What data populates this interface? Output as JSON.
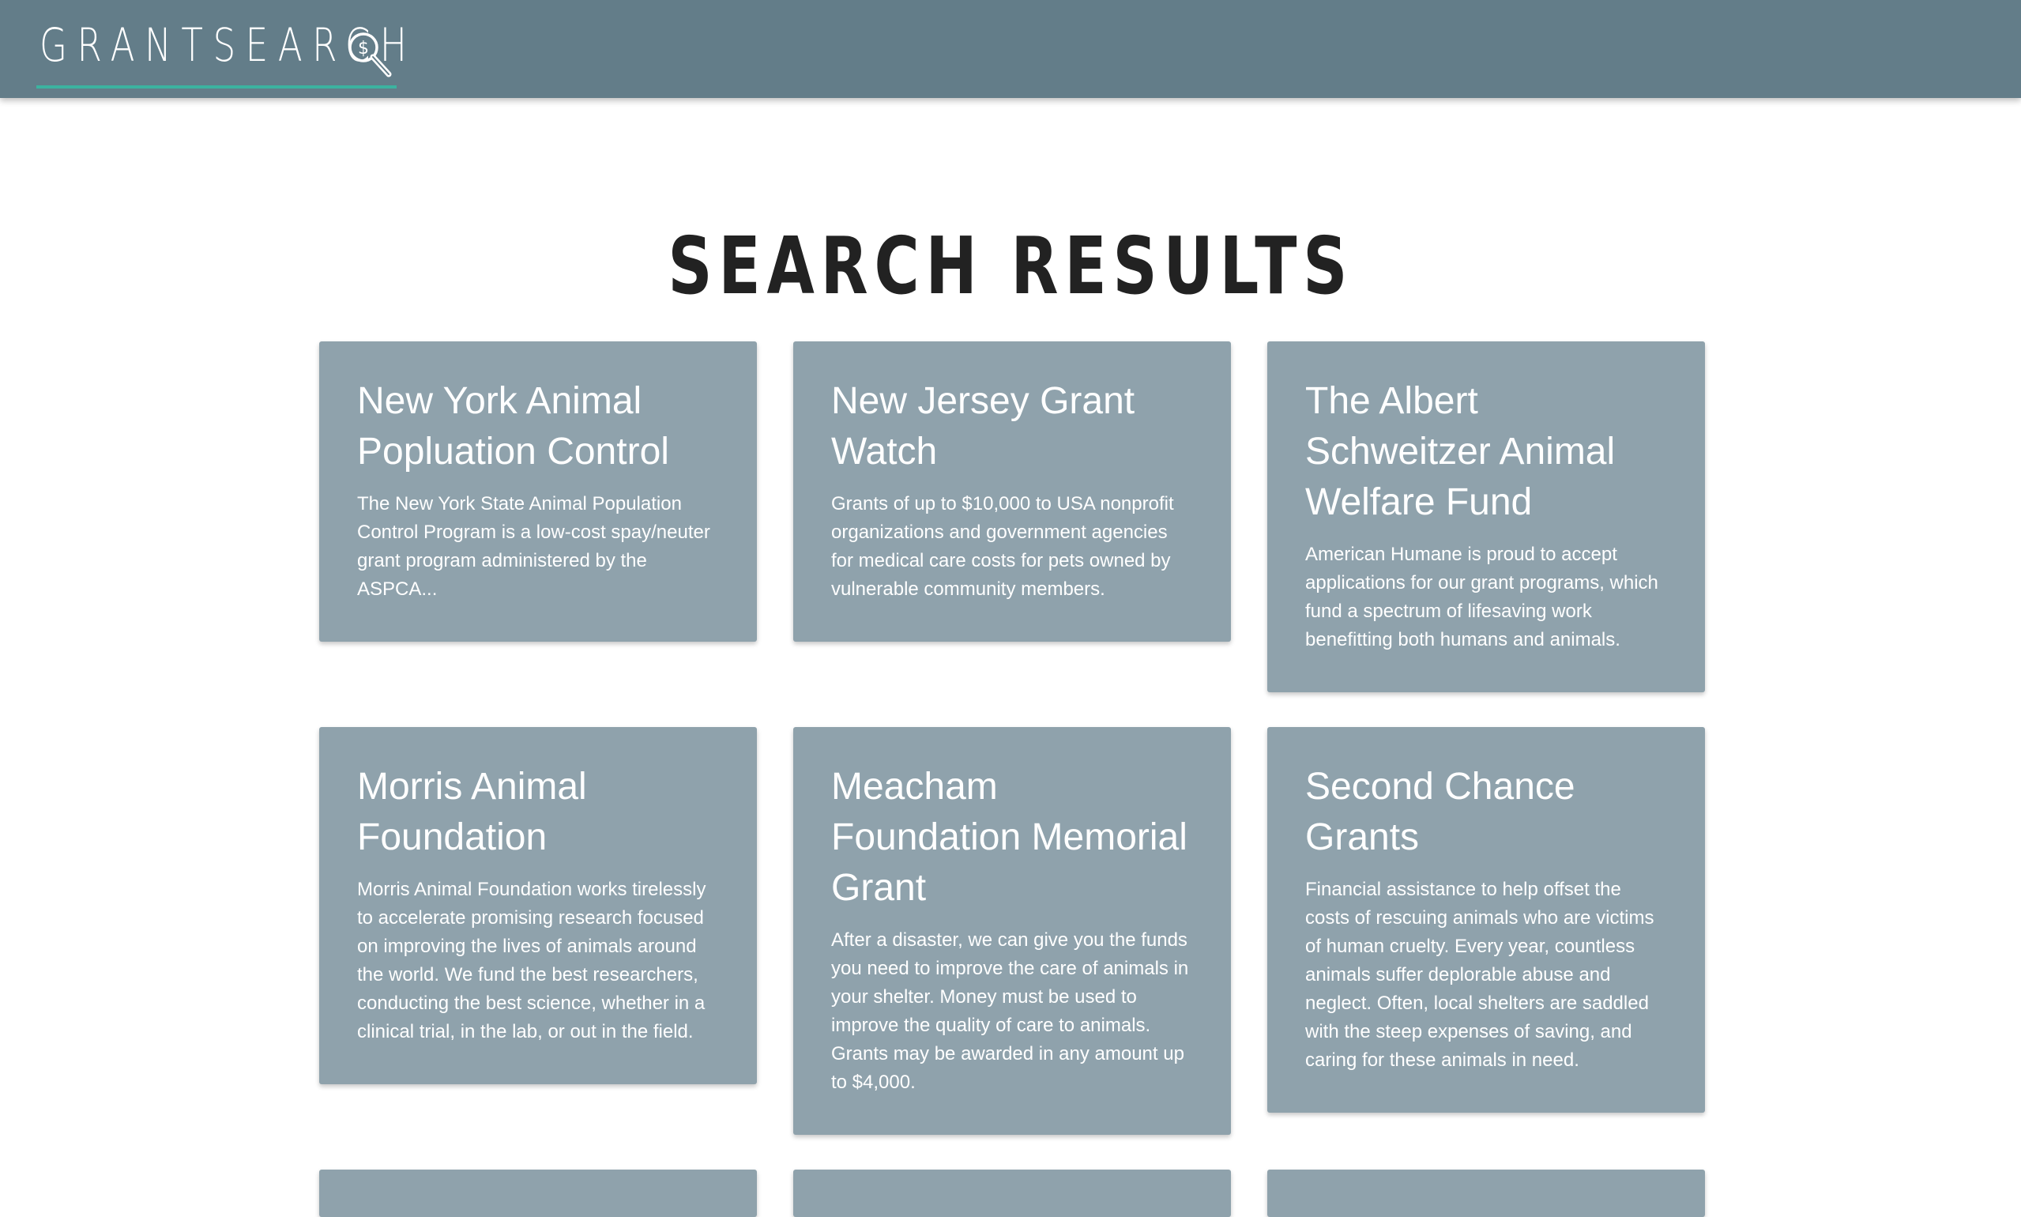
{
  "navbar": {
    "brand": "GRANTSEARCH",
    "brand_icon": "magnifier-dollar-icon",
    "brand_icon_symbol": "$",
    "accent_color": "#3cb3a0",
    "background_color": "#637d89"
  },
  "page": {
    "title": "SEARCH RESULTS"
  },
  "results": [
    {
      "title": "New York Animal Popluation Control",
      "description": "The New York State Animal Population Control Program is a low-cost spay/neuter grant program administered by the ASPCA..."
    },
    {
      "title": "New Jersey Grant Watch",
      "description": "Grants of up to $10,000 to USA nonprofit organizations and government agencies for medical care costs for pets owned by vulnerable community members."
    },
    {
      "title": "The Albert Schweitzer Animal Welfare Fund",
      "description": "American Humane is proud to accept applications for our grant programs, which fund a spectrum of lifesaving work benefitting both humans and animals."
    },
    {
      "title": "Morris Animal Foundation",
      "description": "Morris Animal Foundation works tirelessly to accelerate promising research focused on improving the lives of animals around the world. We fund the best researchers, conducting the best science, whether in a clinical trial, in the lab, or out in the field."
    },
    {
      "title": "Meacham Foundation Memorial Grant",
      "description": "After a disaster, we can give you the funds you need to improve the care of animals in your shelter. Money must be used to improve the quality of care to animals. Grants may be awarded in any amount up to $4,000."
    },
    {
      "title": "Second Chance Grants",
      "description": "Financial assistance to help offset the costs of rescuing animals who are victims of human cruelty. Every year, countless animals suffer deplorable abuse and neglect. Often, local shelters are saddled with the steep expenses of saving, and caring for these animals in need."
    }
  ],
  "card_color": "#8fa2ac"
}
